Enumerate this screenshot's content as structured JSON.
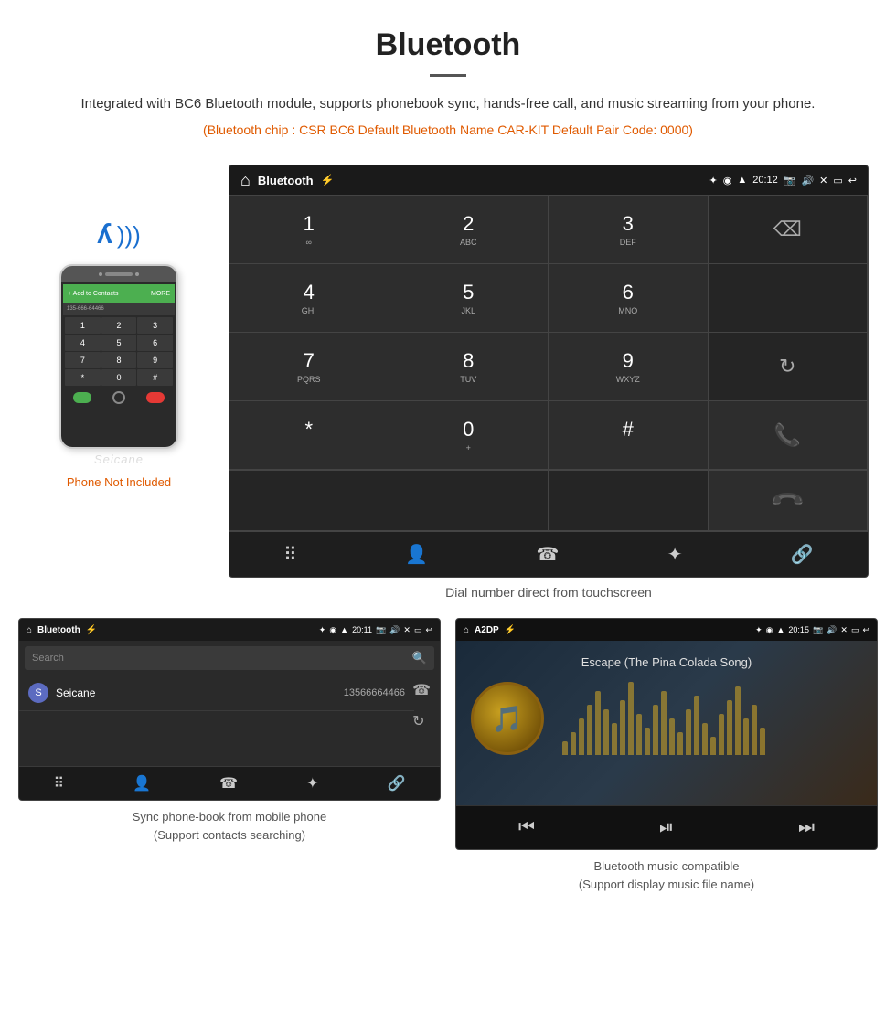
{
  "page": {
    "title": "Bluetooth",
    "divider": true,
    "description": "Integrated with BC6 Bluetooth module, supports phonebook sync, hands-free call, and music streaming from your phone.",
    "specs": "(Bluetooth chip : CSR BC6    Default Bluetooth Name CAR-KIT    Default Pair Code: 0000)",
    "phone_not_included": "Phone Not Included",
    "dial_caption": "Dial number direct from touchscreen",
    "phonebook_caption": "Sync phone-book from mobile phone\n(Support contacts searching)",
    "music_caption": "Bluetooth music compatible\n(Support display music file name)"
  },
  "dialpad_screen": {
    "app_title": "Bluetooth",
    "time": "20:12",
    "keys": [
      {
        "digit": "1",
        "sub": "∞",
        "col": 1
      },
      {
        "digit": "2",
        "sub": "ABC",
        "col": 2
      },
      {
        "digit": "3",
        "sub": "DEF",
        "col": 3
      },
      {
        "digit": "4",
        "sub": "GHI",
        "col": 1
      },
      {
        "digit": "5",
        "sub": "JKL",
        "col": 2
      },
      {
        "digit": "6",
        "sub": "MNO",
        "col": 3
      },
      {
        "digit": "7",
        "sub": "PQRS",
        "col": 1
      },
      {
        "digit": "8",
        "sub": "TUV",
        "col": 2
      },
      {
        "digit": "9",
        "sub": "WXYZ",
        "col": 3
      },
      {
        "digit": "*",
        "sub": "",
        "col": 1
      },
      {
        "digit": "0",
        "sub": "+",
        "col": 2
      },
      {
        "digit": "#",
        "sub": "",
        "col": 3
      }
    ]
  },
  "phonebook_screen": {
    "app_title": "Bluetooth",
    "time": "20:11",
    "search_placeholder": "Search",
    "contact_letter": "S",
    "contact_name": "Seicane",
    "contact_number": "13566664466"
  },
  "music_screen": {
    "app_title": "A2DP",
    "time": "20:15",
    "song_title": "Escape (The Pina Colada Song)",
    "visualizer_heights": [
      15,
      25,
      40,
      55,
      70,
      50,
      35,
      60,
      80,
      45,
      30,
      55,
      70,
      40,
      25,
      50,
      65,
      35,
      20,
      45,
      60,
      75,
      40,
      55,
      30
    ]
  },
  "icons": {
    "home": "⌂",
    "bluetooth": "⚡",
    "usb": "⚙",
    "bluetooth_symbol": "❋",
    "map_pin": "◉",
    "wifi": "▲",
    "time_icon": "⏱",
    "camera": "📷",
    "volume": "🔊",
    "close_x": "✕",
    "window": "▭",
    "back": "↩",
    "backspace": "⌫",
    "refresh": "↻",
    "call": "📞",
    "end_call": "📞",
    "dialpad": "⠿",
    "person": "👤",
    "phone": "☎",
    "bt": "⚡",
    "link": "🔗",
    "search": "🔍",
    "prev": "⏮",
    "play_pause": "⏯",
    "next": "⏭",
    "music_note": "🎵"
  }
}
